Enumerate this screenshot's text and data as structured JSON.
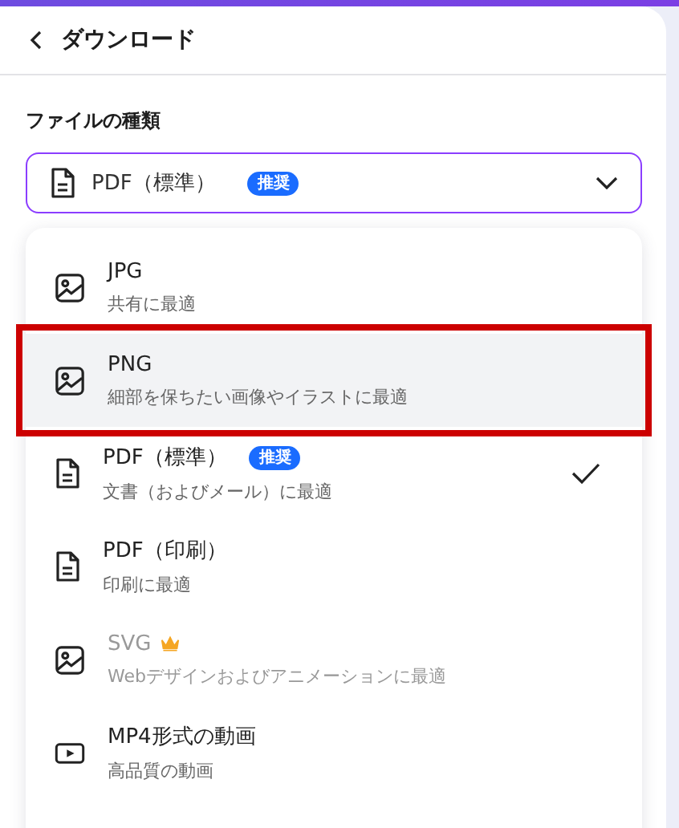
{
  "header": {
    "title": "ダウンロード"
  },
  "file_type": {
    "label": "ファイルの種類",
    "value": "PDF（標準）",
    "badge": "推奨"
  },
  "options": [
    {
      "kind": "image",
      "name": "JPG",
      "description": "共有に最適",
      "hovered": false,
      "highlighted": false,
      "selected": false,
      "premium": false
    },
    {
      "kind": "image",
      "name": "PNG",
      "description": "細部を保ちたい画像やイラストに最適",
      "hovered": true,
      "highlighted": true,
      "selected": false,
      "premium": false
    },
    {
      "kind": "document",
      "name": "PDF（標準）",
      "badge": "推奨",
      "description": "文書（およびメール）に最適",
      "hovered": false,
      "highlighted": false,
      "selected": true,
      "premium": false
    },
    {
      "kind": "document",
      "name": "PDF（印刷）",
      "description": "印刷に最適",
      "hovered": false,
      "highlighted": false,
      "selected": false,
      "premium": false
    },
    {
      "kind": "image",
      "name": "SVG",
      "description": "Webデザインおよびアニメーションに最適",
      "hovered": false,
      "highlighted": false,
      "selected": false,
      "premium": true
    },
    {
      "kind": "video",
      "name": "MP4形式の動画",
      "description": "高品質の動画",
      "hovered": false,
      "highlighted": false,
      "selected": false,
      "premium": false
    }
  ]
}
